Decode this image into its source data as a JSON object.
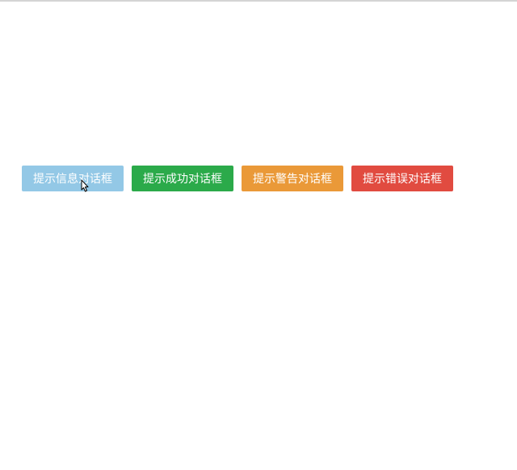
{
  "buttons": {
    "info_label": "提示信息对话框",
    "success_label": "提示成功对话框",
    "warning_label": "提示警告对话框",
    "error_label": "提示错误对话框"
  },
  "colors": {
    "info": "#93c8e6",
    "success": "#2baa4a",
    "warning": "#ea9938",
    "error": "#e14b40"
  }
}
